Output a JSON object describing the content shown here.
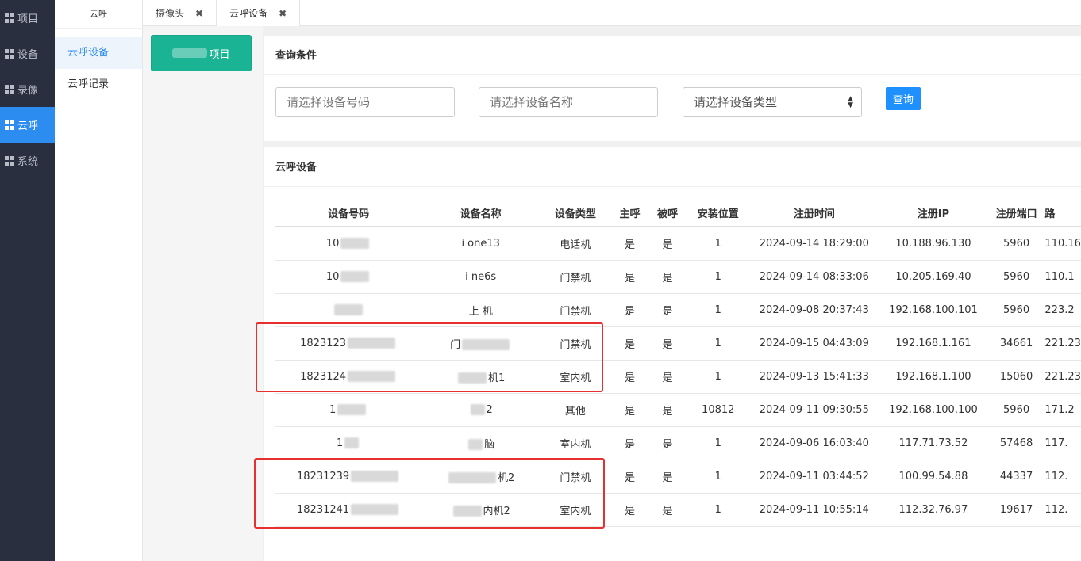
{
  "nav": {
    "items": [
      {
        "label": "项目",
        "icon": "grid-icon"
      },
      {
        "label": "设备",
        "icon": "grid-icon"
      },
      {
        "label": "录像",
        "icon": "grid-icon"
      },
      {
        "label": "云呼",
        "icon": "grid-icon",
        "active": true
      },
      {
        "label": "系统",
        "icon": "grid-icon"
      }
    ]
  },
  "submenu": {
    "title": "云呼",
    "items": [
      {
        "label": "云呼设备",
        "active": true
      },
      {
        "label": "云呼记录"
      }
    ]
  },
  "tabs": [
    {
      "label": "摄像头",
      "close": "✖"
    },
    {
      "label": "云呼设备",
      "close": "✖",
      "active": true
    }
  ],
  "add_button": {
    "label": "项目"
  },
  "query": {
    "title": "查询条件",
    "device_no_placeholder": "请选择设备号码",
    "device_name_placeholder": "请选择设备名称",
    "device_type_value": "请选择设备类型",
    "query_label": "查询"
  },
  "list": {
    "title": "云呼设备",
    "columns": [
      "设备号码",
      "设备名称",
      "设备类型",
      "主呼",
      "被呼",
      "安装位置",
      "注册时间",
      "注册IP",
      "注册端口",
      "路"
    ],
    "rows": [
      {
        "no": "10",
        "name": "i one13",
        "type": "电话机",
        "caller": "是",
        "callee": "是",
        "location": "1",
        "reg_time": "2024-09-14 18:29:00",
        "ip": "10.188.96.130",
        "port": "5960",
        "route": "110.16"
      },
      {
        "no": "10",
        "name": "i ne6s",
        "type": "门禁机",
        "caller": "是",
        "callee": "是",
        "location": "1",
        "reg_time": "2024-09-14 08:33:06",
        "ip": "10.205.169.40",
        "port": "5960",
        "route": "110.1"
      },
      {
        "no": "",
        "name": "上 机",
        "type": "门禁机",
        "caller": "是",
        "callee": "是",
        "location": "1",
        "reg_time": "2024-09-08 20:37:43",
        "ip": "192.168.100.101",
        "port": "5960",
        "route": "223.2"
      },
      {
        "no": "1823123",
        "name": "门",
        "type": "门禁机",
        "caller": "是",
        "callee": "是",
        "location": "1",
        "reg_time": "2024-09-15 04:43:09",
        "ip": "192.168.1.161",
        "port": "34661",
        "route": "221.23"
      },
      {
        "no": "1823124",
        "name": "机1",
        "type": "室内机",
        "caller": "是",
        "callee": "是",
        "location": "1",
        "reg_time": "2024-09-13 15:41:33",
        "ip": "192.168.1.100",
        "port": "15060",
        "route": "221.23"
      },
      {
        "no": "1",
        "name": "2",
        "type": "其他",
        "caller": "是",
        "callee": "是",
        "location": "10812",
        "reg_time": "2024-09-11 09:30:55",
        "ip": "192.168.100.100",
        "port": "5960",
        "route": "171.2"
      },
      {
        "no": "1",
        "name": "脑",
        "type": "室内机",
        "caller": "是",
        "callee": "是",
        "location": "1",
        "reg_time": "2024-09-06 16:03:40",
        "ip": "117.71.73.52",
        "port": "57468",
        "route": "117."
      },
      {
        "no": "18231239",
        "name": "机2",
        "type": "门禁机",
        "caller": "是",
        "callee": "是",
        "location": "1",
        "reg_time": "2024-09-11 03:44:52",
        "ip": "100.99.54.88",
        "port": "44337",
        "route": "112."
      },
      {
        "no": "18231241",
        "name": "内机2",
        "type": "室内机",
        "caller": "是",
        "callee": "是",
        "location": "1",
        "reg_time": "2024-09-11 10:55:14",
        "ip": "112.32.76.97",
        "port": "19617",
        "route": "112."
      }
    ]
  },
  "colors": {
    "accent": "#2d8cf0",
    "add_button": "#1ab394",
    "query_button": "#1e90ff",
    "highlight_box": "#e63030",
    "nav_bg": "#2a2f3f"
  }
}
